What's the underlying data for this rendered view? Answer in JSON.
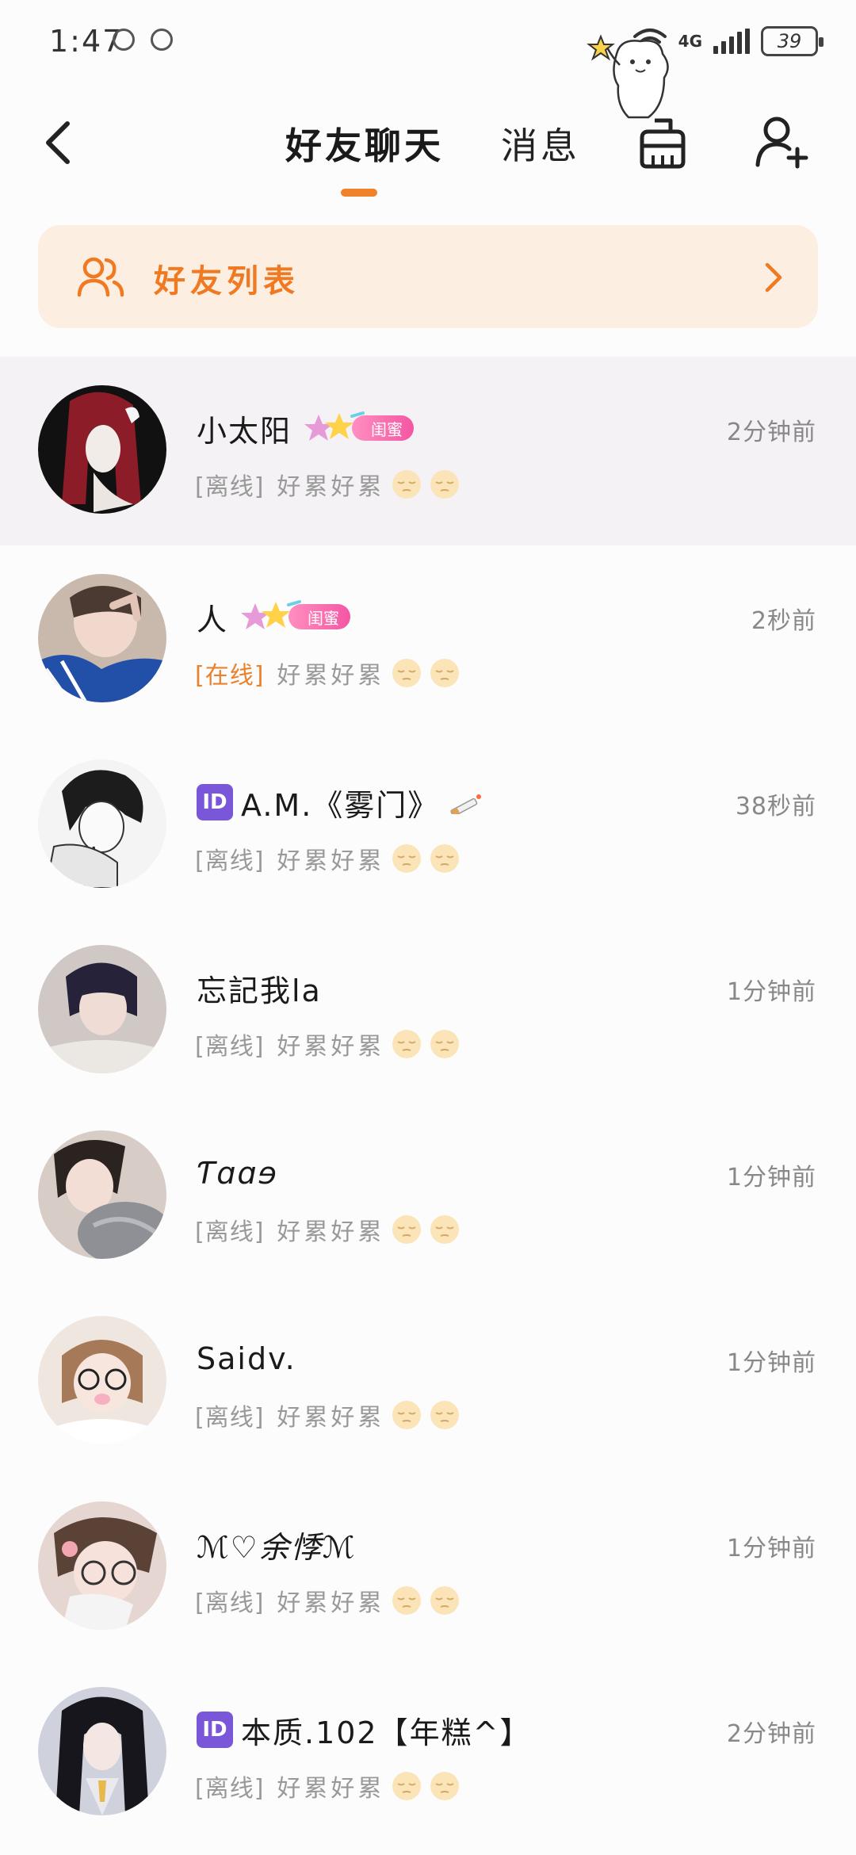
{
  "status_bar": {
    "time": "1:47",
    "network": "4G",
    "battery": "39"
  },
  "header": {
    "tabs": [
      {
        "label": "好友聊天",
        "active": true
      },
      {
        "label": "消息",
        "active": false
      }
    ],
    "accent_color": "#f0822a"
  },
  "banner": {
    "label": "好友列表",
    "color": "#ef7a22",
    "background": "#fdeee2"
  },
  "chats": [
    {
      "name": "小太阳",
      "badge": "闺蜜",
      "time": "2分钟前",
      "status": "[离线]",
      "message": "好累好累",
      "emoji": "pensive-face"
    },
    {
      "name": "人",
      "badge": "闺蜜",
      "time": "2秒前",
      "status": "[在线]",
      "message": "好累好累",
      "emoji": "pensive-face"
    },
    {
      "id_badge": "ID",
      "name": "A.M.《雾门》",
      "time": "38秒前",
      "status": "[离线]",
      "message": "好累好累",
      "emoji": "pensive-face"
    },
    {
      "name": "忘記我la",
      "time": "1分钟前",
      "status": "[离线]",
      "message": "好累好累",
      "emoji": "pensive-face"
    },
    {
      "name": "Ƭɑɑɘ",
      "time": "1分钟前",
      "status": "[离线]",
      "message": "好累好累",
      "emoji": "pensive-face"
    },
    {
      "name": "Saidv.",
      "time": "1分钟前",
      "status": "[离线]",
      "message": "好累好累",
      "emoji": "pensive-face"
    },
    {
      "name": "ℳ♡余悸ℳ",
      "time": "1分钟前",
      "status": "[离线]",
      "message": "好累好累",
      "emoji": "pensive-face"
    },
    {
      "id_badge": "ID",
      "name": "本质.102【年糕^】",
      "time": "2分钟前",
      "status": "[离线]",
      "message": "好累好累",
      "emoji": "pensive-face"
    }
  ],
  "colors": {
    "online": "#e9822c",
    "id_badge": "#7a57d9",
    "relation_badge": "#f456a4"
  }
}
